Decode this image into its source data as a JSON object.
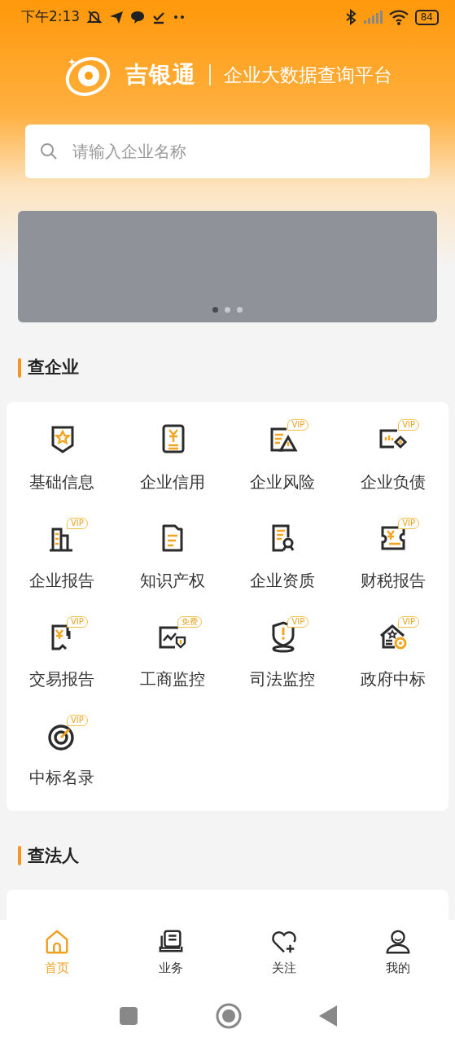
{
  "status_bar": {
    "time": "下午2:13",
    "battery": "84"
  },
  "header": {
    "brand": "吉银通",
    "tagline": "企业大数据查询平台"
  },
  "search": {
    "placeholder": "请输入企业名称"
  },
  "banner": {
    "dots": [
      {
        "selected": true
      },
      {
        "selected": false
      },
      {
        "selected": false
      }
    ]
  },
  "sections": [
    {
      "title": "查企业",
      "items": [
        {
          "label": "基础信息"
        },
        {
          "label": "企业信用"
        },
        {
          "label": "企业风险",
          "badge": "VIP"
        },
        {
          "label": "企业负债",
          "badge": "VIP"
        },
        {
          "label": "企业报告",
          "badge": "VIP"
        },
        {
          "label": "知识产权"
        },
        {
          "label": "企业资质"
        },
        {
          "label": "财税报告",
          "badge": "VIP"
        },
        {
          "label": "交易报告",
          "badge": "VIP"
        },
        {
          "label": "工商监控",
          "badge": "免费"
        },
        {
          "label": "司法监控",
          "badge": "VIP"
        },
        {
          "label": "政府中标",
          "badge": "VIP"
        },
        {
          "label": "中标名录",
          "badge": "VIP"
        }
      ]
    },
    {
      "title": "查法人"
    }
  ],
  "bottom_nav": [
    {
      "label": "首页",
      "selected": true
    },
    {
      "label": "业务",
      "selected": false
    },
    {
      "label": "关注",
      "selected": false
    },
    {
      "label": "我的",
      "selected": false
    }
  ]
}
